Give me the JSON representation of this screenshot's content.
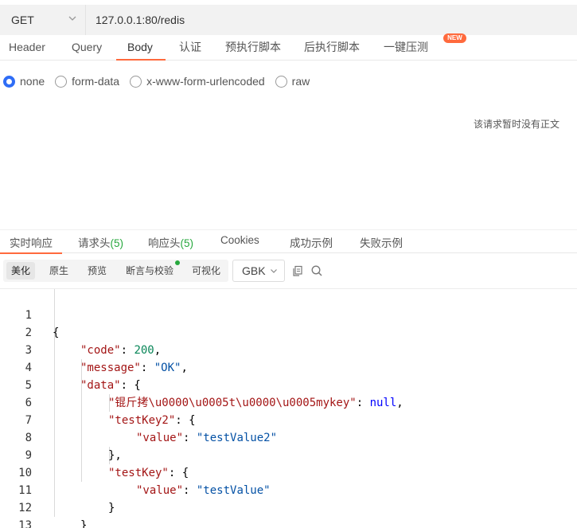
{
  "request": {
    "method": "GET",
    "url": "127.0.0.1:80/redis"
  },
  "request_tabs": [
    "Header",
    "Query",
    "Body",
    "认证",
    "预执行脚本",
    "后执行脚本",
    "一键压测"
  ],
  "new_badge": "NEW",
  "body_types": {
    "options": [
      "none",
      "form-data",
      "x-www-form-urlencoded",
      "raw"
    ],
    "selected": "none"
  },
  "no_body_text": "该请求暂时没有正文",
  "response_tabs": {
    "realtime": "实时响应",
    "req_headers": "请求头",
    "req_headers_count": "(5)",
    "resp_headers": "响应头",
    "resp_headers_count": "(5)",
    "cookies": "Cookies",
    "success_example": "成功示例",
    "fail_example": "失败示例"
  },
  "view_modes": [
    "美化",
    "原生",
    "预览",
    "断言与校验",
    "可视化"
  ],
  "encoding": "GBK",
  "icons": {
    "method_dropdown": "chevron-down-icon",
    "encoding_dropdown": "chevron-down-icon",
    "copy": "copy-icon",
    "search": "search-icon"
  },
  "colors": {
    "accent": "#ff6a3d",
    "radio_selected": "#2f6df6",
    "count_green": "#27a83e",
    "json_key": "#a31515",
    "json_string": "#0451a5",
    "json_number": "#098658",
    "json_null": "#0000ff"
  },
  "code": {
    "line_numbers": [
      "1",
      "2",
      "3",
      "4",
      "5",
      "6",
      "7",
      "8",
      "9",
      "10",
      "11",
      "12",
      "13"
    ],
    "l1": "{",
    "l2_key": "\"code\"",
    "l2_sep": ": ",
    "l2_val": "200",
    "l2_end": ",",
    "l3_key": "\"message\"",
    "l3_sep": ": ",
    "l3_val": "\"OK\"",
    "l3_end": ",",
    "l4_key": "\"data\"",
    "l4_end": ": {",
    "l5_key": "\"锟斤拷\\u0000\\u0005t\\u0000\\u0005mykey\"",
    "l5_sep": ": ",
    "l5_val": "null",
    "l5_end": ",",
    "l6_key": "\"testKey2\"",
    "l6_end": ": {",
    "l7_key": "\"value\"",
    "l7_sep": ": ",
    "l7_val": "\"testValue2\"",
    "l8": "},",
    "l9_key": "\"testKey\"",
    "l9_end": ": {",
    "l10_key": "\"value\"",
    "l10_sep": ": ",
    "l10_val": "\"testValue\"",
    "l11": "}",
    "l12": "}",
    "l13": "}"
  }
}
